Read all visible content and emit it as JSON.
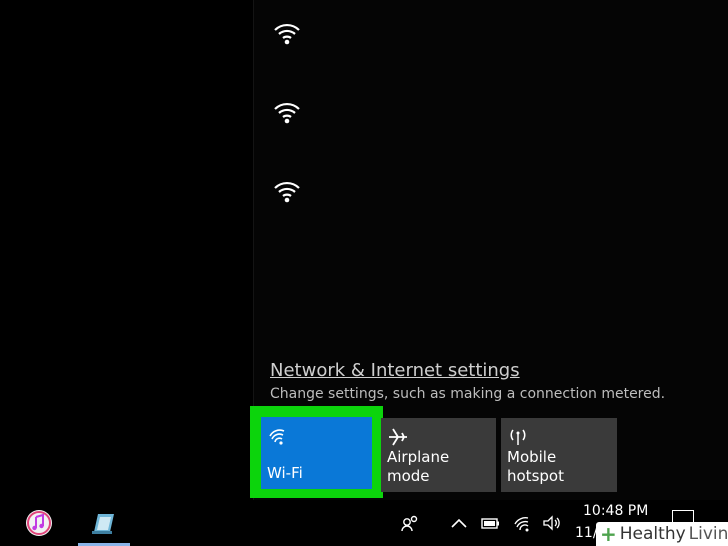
{
  "network_list": {
    "items": [
      {
        "icon": "wifi-signal-icon"
      },
      {
        "icon": "wifi-signal-icon"
      },
      {
        "icon": "wifi-signal-icon"
      }
    ]
  },
  "settings": {
    "link_label": "Network & Internet settings",
    "description": "Change settings, such as making a connection metered."
  },
  "quick_actions": {
    "wifi": {
      "label": "Wi-Fi",
      "state": "on",
      "color": "#0a78d7"
    },
    "airplane": {
      "label": "Airplane mode"
    },
    "hotspot": {
      "label_line1": "Mobile",
      "label_line2": "hotspot"
    }
  },
  "highlight_color": "#0cd40c",
  "taskbar": {
    "pinned": [
      {
        "name": "itunes",
        "icon": "itunes-icon"
      },
      {
        "name": "notes-app",
        "icon": "notebook-icon"
      }
    ],
    "tray": [
      "people-icon",
      "chevron-up-icon",
      "battery-icon",
      "wifi-icon",
      "volume-icon"
    ],
    "clock": {
      "time": "10:48 PM",
      "date": "11/"
    }
  },
  "watermark": {
    "brand": "Healthy",
    "suffix": "Living"
  }
}
